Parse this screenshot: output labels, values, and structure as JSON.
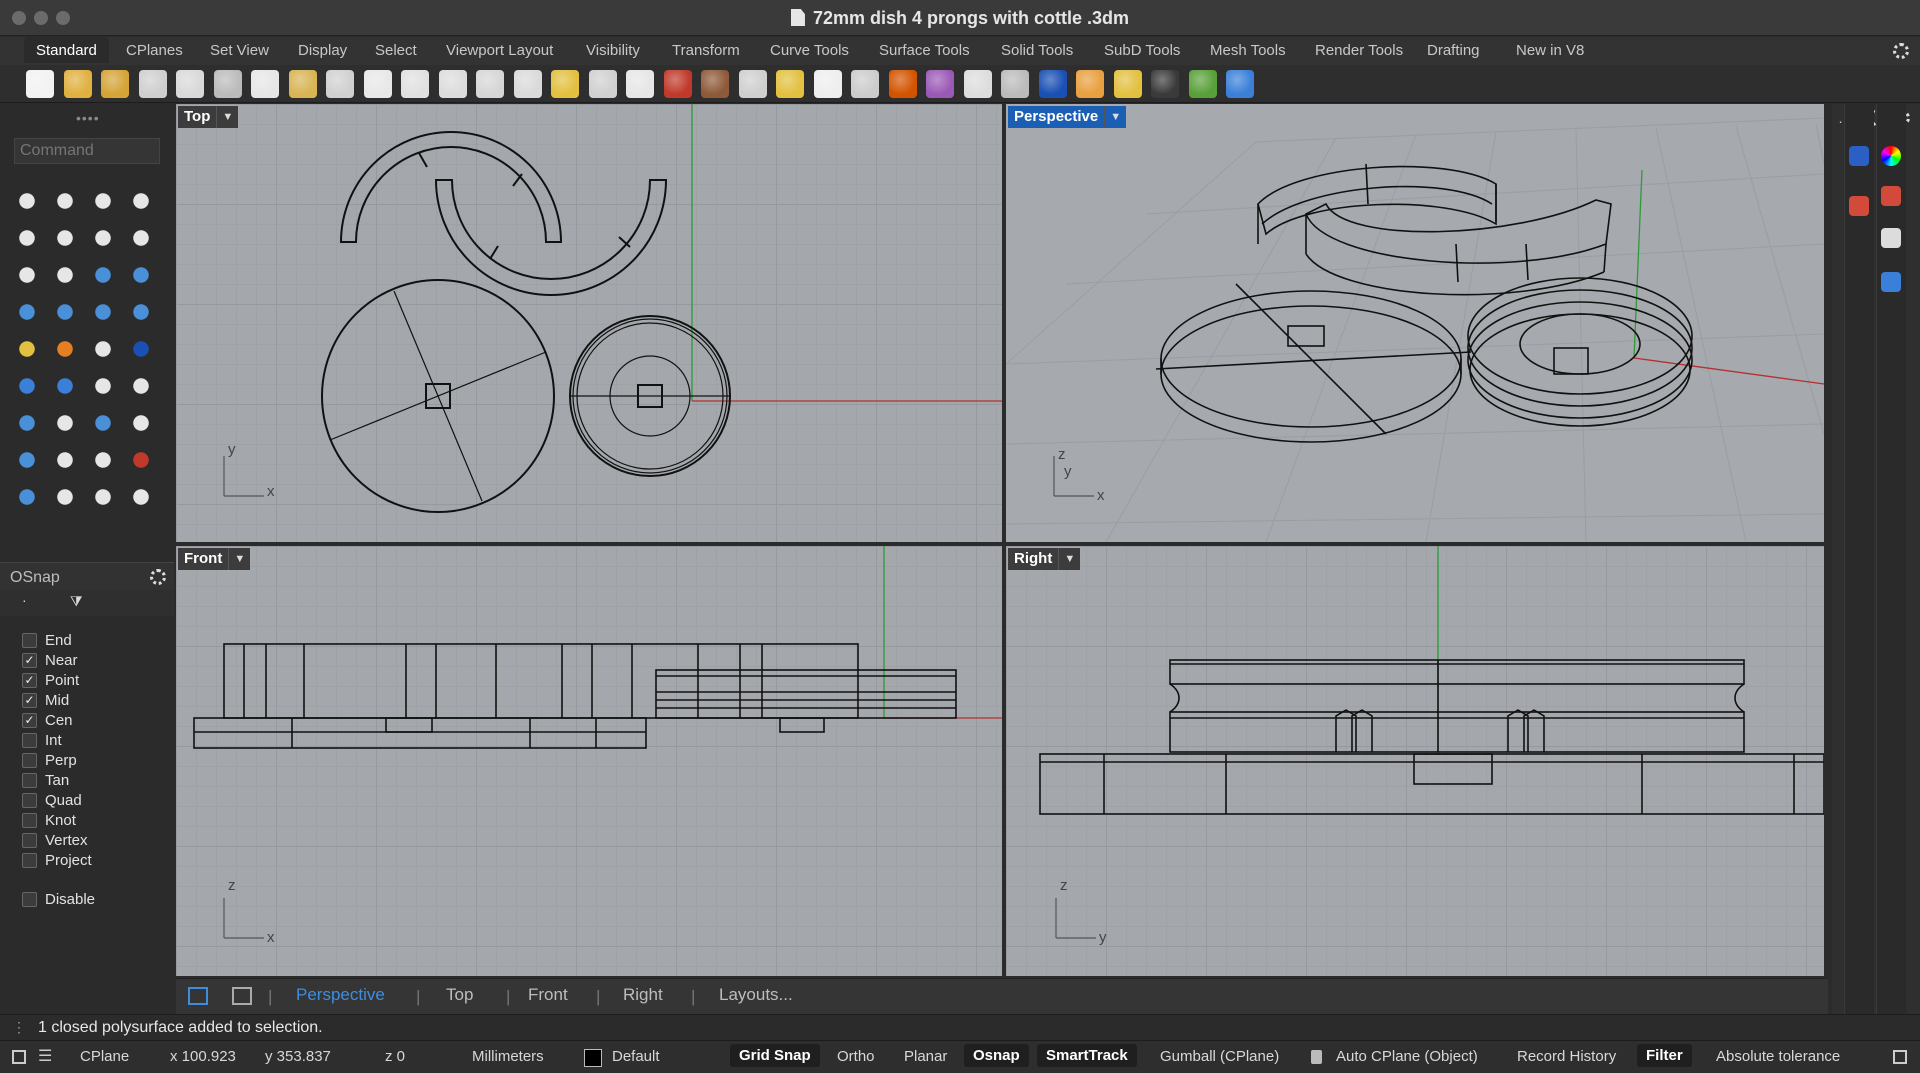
{
  "window": {
    "title": "72mm dish 4 prongs with cottle .3dm"
  },
  "tabs": [
    "Standard",
    "CPlanes",
    "Set View",
    "Display",
    "Select",
    "Viewport Layout",
    "Visibility",
    "Transform",
    "Curve Tools",
    "Surface Tools",
    "Solid Tools",
    "SubD Tools",
    "Mesh Tools",
    "Render Tools",
    "Drafting",
    "New in V8"
  ],
  "toolbar": {
    "icons": [
      "new-icon",
      "open-icon",
      "save-icon",
      "print-icon",
      "import-icon",
      "cut-icon",
      "copy-icon",
      "paste-icon",
      "undo-icon",
      "pan-icon",
      "rotate-view-icon",
      "zoom-icon",
      "zoom-window-icon",
      "zoom-extents-icon",
      "zoom-selected-icon",
      "undo-view-icon",
      "four-viewports-icon",
      "car-icon",
      "plane-icon",
      "cplane-icon",
      "osnap-icon",
      "lightbulb-icon",
      "lock-icon",
      "layer-icon",
      "color-wheel-icon",
      "render-sphere-icon",
      "wireframe-sphere-icon",
      "shaded-sphere-icon",
      "rendered-sphere-icon",
      "settings-gear-icon",
      "grasshopper-icon",
      "python-icon",
      "help-icon"
    ],
    "colors": [
      "#f2f2f2",
      "#e0b040",
      "#d4a437",
      "#cfcfcf",
      "#d9d9d9",
      "#bbbbbb",
      "#e6e6e6",
      "#d8b455",
      "#d0d0d0",
      "#e8e8e8",
      "#e0e0e0",
      "#dcdcdc",
      "#d6d6d6",
      "#dadada",
      "#e2c040",
      "#d0d0d0",
      "#e6e6e6",
      "#c0392b",
      "#8e5a3a",
      "#cfcfcf",
      "#e2c040",
      "#eeeeee",
      "#cccccc",
      "#d35400",
      "#9b59b6",
      "#dddddd",
      "#bbbbbb",
      "#1a4fb4",
      "#e8a040",
      "#e2c040",
      "#3a3a3a",
      "#5aa03a",
      "#3a7fd8"
    ]
  },
  "command": {
    "placeholder": "Command"
  },
  "tools": {
    "icons": [
      "select-icon",
      "point-icon",
      "polyline-icon",
      "curve-icon",
      "circle-icon",
      "ellipse-icon",
      "arc-icon",
      "rectangle-icon",
      "polygon-icon",
      "fillet-icon",
      "surface-icon",
      "extrude-icon",
      "box-icon",
      "sphere-icon",
      "cylinder-icon",
      "mesh-icon",
      "gear-tool-icon",
      "explode-icon",
      "split-icon",
      "trim-icon",
      "boolean-icon",
      "points-icon",
      "curve-edit-icon",
      "offset-icon",
      "text-icon",
      "scale-icon",
      "array-icon",
      "edit-icon",
      "solid-icon",
      "dimension-icon",
      "grid-icon",
      "ruler-icon",
      "sketch-icon",
      "analyze-icon",
      "check-icon",
      "more-icon"
    ],
    "colors": [
      "#e6e6e6",
      "#e6e6e6",
      "#e6e6e6",
      "#e6e6e6",
      "#e6e6e6",
      "#e6e6e6",
      "#e6e6e6",
      "#e6e6e6",
      "#e6e6e6",
      "#e6e6e6",
      "#4a90d9",
      "#4a90d9",
      "#4a90d9",
      "#4a90d9",
      "#4a90d9",
      "#4a90d9",
      "#e2c040",
      "#e67e22",
      "#e6e6e6",
      "#1a4fb4",
      "#3a7fd8",
      "#3a7fd8",
      "#e6e6e6",
      "#e6e6e6",
      "#4a90d9",
      "#e6e6e6",
      "#4a90d9",
      "#e6e6e6",
      "#4a90d9",
      "#e6e6e6",
      "#e6e6e6",
      "#c0392b",
      "#4a90d9",
      "#e6e6e6",
      "#e6e6e6",
      "#e6e6e6"
    ]
  },
  "osnap": {
    "title": "OSnap",
    "items": [
      {
        "label": "End",
        "checked": false
      },
      {
        "label": "Near",
        "checked": true
      },
      {
        "label": "Point",
        "checked": true
      },
      {
        "label": "Mid",
        "checked": true
      },
      {
        "label": "Cen",
        "checked": true
      },
      {
        "label": "Int",
        "checked": false
      },
      {
        "label": "Perp",
        "checked": false
      },
      {
        "label": "Tan",
        "checked": false
      },
      {
        "label": "Quad",
        "checked": false
      },
      {
        "label": "Knot",
        "checked": false
      },
      {
        "label": "Vertex",
        "checked": false
      },
      {
        "label": "Project",
        "checked": false
      }
    ],
    "disable": {
      "label": "Disable",
      "checked": false
    }
  },
  "viewports": {
    "top": {
      "name": "Top",
      "axes": [
        "y",
        "x"
      ]
    },
    "perspective": {
      "name": "Perspective",
      "axes": [
        "z",
        "y",
        "x"
      ]
    },
    "front": {
      "name": "Front",
      "axes": [
        "z",
        "x"
      ]
    },
    "right": {
      "name": "Right",
      "axes": [
        "z",
        "y"
      ]
    }
  },
  "viewport_tabs": [
    "Perspective",
    "Top",
    "Front",
    "Right",
    "Layouts..."
  ],
  "command_history": "1 closed polysurface added to selection.",
  "status": {
    "cplane": "CPlane",
    "x": "x 100.923",
    "y": "y 353.837",
    "z": "z 0",
    "units": "Millimeters",
    "layer": "Default",
    "grid_snap": "Grid Snap",
    "ortho": "Ortho",
    "planar": "Planar",
    "osnap": "Osnap",
    "smarttrack": "SmartTrack",
    "gumball": "Gumball (CPlane)",
    "auto_cplane": "Auto CPlane (Object)",
    "record_history": "Record History",
    "filter": "Filter",
    "tolerance": "Absolute tolerance"
  }
}
